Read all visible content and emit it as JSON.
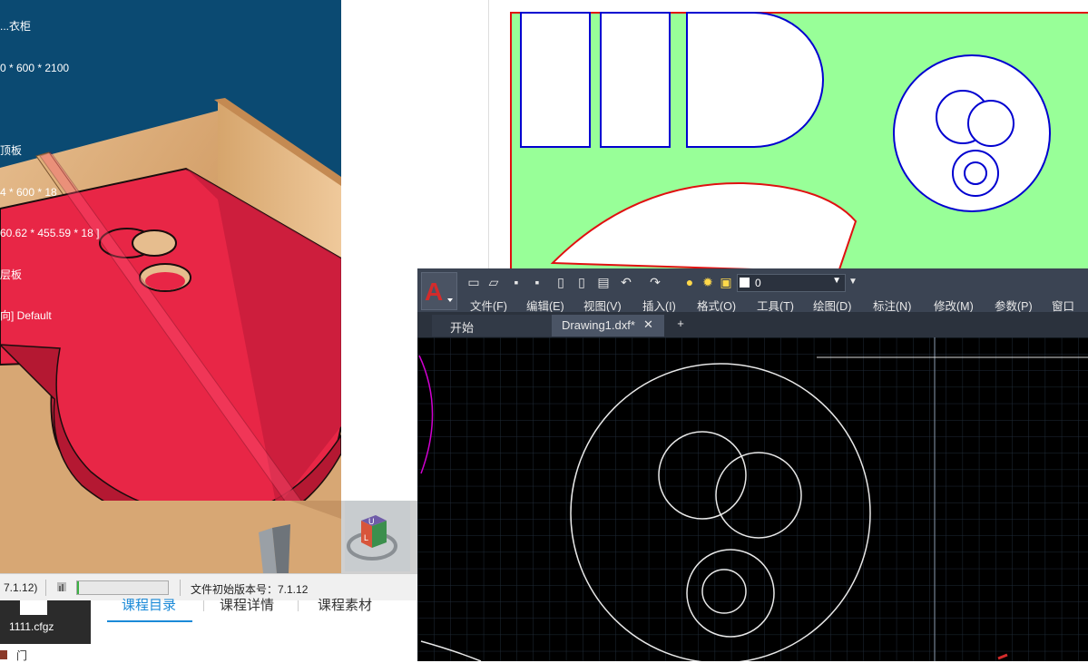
{
  "viewport3d": {
    "info_lines": [
      "...衣柜",
      "0 * 600 * 2100",
      "",
      "顶板",
      "4 * 600 * 18",
      "60.62 * 455.59 * 18 ]",
      "层板",
      "向] Default"
    ]
  },
  "viewcube": {
    "face_label": "U",
    "side_label": "L"
  },
  "left_status": {
    "version_suffix": "7.1.12)",
    "progress_fraction": 0.02,
    "file_version_label": "文件初始版本号：7.1.12"
  },
  "file_pane": {
    "file_name": "1111.cfgz",
    "bottom_label": "门"
  },
  "course_tabs": [
    "课程目录",
    "课程详情",
    "课程素材"
  ],
  "cad": {
    "colors": {
      "toolbar": "#3b4453",
      "canvas": "#000000",
      "accent_red": "#d42b2b"
    },
    "layer_value": "0",
    "menus": [
      "文件(F)",
      "编辑(E)",
      "视图(V)",
      "插入(I)",
      "格式(O)",
      "工具(T)",
      "绘图(D)",
      "标注(N)",
      "修改(M)",
      "参数(P)",
      "窗口(W"
    ],
    "tabs": [
      {
        "label": "开始",
        "close": ""
      },
      {
        "label": "Drawing1.dxf*",
        "close": "✕"
      }
    ],
    "new_tab": "+",
    "toolbar_icons": [
      "new-file-icon",
      "open-folder-icon",
      "save-icon",
      "save-as-icon",
      "export-icon",
      "import-icon",
      "print-icon",
      "undo-icon",
      "redo-icon",
      "bulb-icon",
      "sun-icon",
      "lock-icon",
      "color-square-icon"
    ]
  }
}
